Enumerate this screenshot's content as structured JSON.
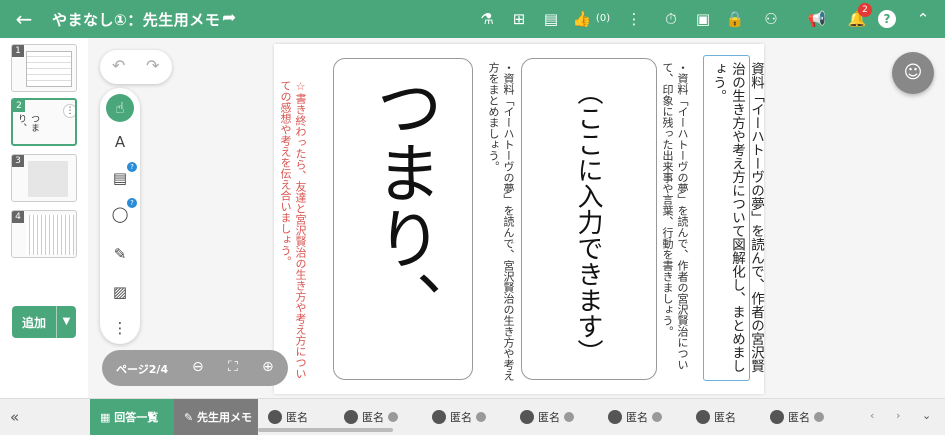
{
  "header": {
    "title": "やまなし①：先生用メモ",
    "notification_count": "2",
    "like_count": "0",
    "icons": [
      "back-arrow-icon",
      "share-icon",
      "flask-icon",
      "hierarchy-icon",
      "comment-icon",
      "thumbs-up-icon",
      "more-vertical-icon",
      "timer-icon",
      "screen-share-icon",
      "lock-icon",
      "pair-icon",
      "megaphone-icon",
      "bell-icon",
      "help-icon",
      "chevron-up-double-icon"
    ]
  },
  "thumbnails": [
    {
      "num": "1"
    },
    {
      "num": "2",
      "text": "つまり、"
    },
    {
      "num": "3"
    },
    {
      "num": "4"
    }
  ],
  "sidebar": {
    "add_label": "追加"
  },
  "tools": [
    "undo-icon",
    "redo-icon",
    "pointer-icon",
    "text-icon",
    "sticky-note-icon",
    "shape-icon",
    "pen-icon",
    "image-icon",
    "more-vertical-icon"
  ],
  "page_nav": {
    "label": "ページ2/4"
  },
  "canvas": {
    "material_text": "資料「イーハトーヴの夢」を読んで、作者の宮沢賢治の生き方や考え方について図解化し、まとめましょう。",
    "instruction_1": "・資料「イーハトーヴの夢」を読んで、作者の宮沢賢治について、印象に残った出来事や言葉、行動を書きましょう。",
    "placeholder_box": "（ここに入力できます）",
    "instruction_2": "・資料「イーハトーヴの夢」を読んで、宮沢賢治の生き方や考え方をまとめましょう。",
    "big_text": "つまり、",
    "red_text": "☆書き終わったら、友達と宮沢賢治の生き方や考え方についての感想や考えを伝え合いましょう。"
  },
  "bottom": {
    "answer_list": "回答一覧",
    "teacher_memo": "先生用メモ",
    "students": [
      "匿名",
      "匿名",
      "匿名",
      "匿名",
      "匿名",
      "匿名",
      "匿名"
    ]
  },
  "colors": {
    "accent": "#4aa77b",
    "accent_dark": "#2e7d6c",
    "red_text": "#d9534f"
  }
}
